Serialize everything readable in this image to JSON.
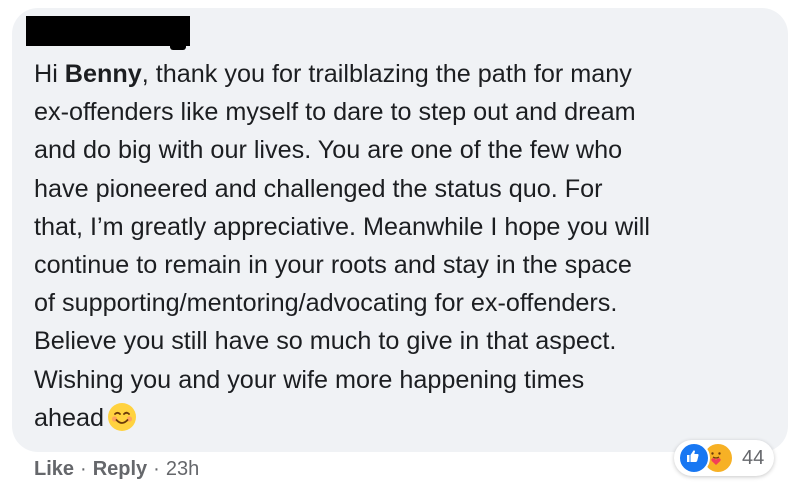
{
  "comment": {
    "lines": [
      [
        "Hi ",
        "Benny",
        ", thank you for trailblazing the path for many"
      ],
      "ex-offenders like myself to dare to step out and dream",
      "and do big with our lives. You are one of the few who",
      "have pioneered and challenged the status quo. For",
      "that, I’m greatly appreciative. Meanwhile I hope you will",
      "continue to remain in your roots and stay in the space",
      "of supporting/mentoring/advocating for ex-offenders.",
      "Believe you still have so much to give in that aspect.",
      "Wishing you and your wife more happening times",
      "ahead"
    ],
    "line1_prefix": "Hi ",
    "mention": "Benny",
    "line1_suffix": ", thank you for trailblazing the path for many",
    "line2": "ex-offenders like myself to dare to step out and dream",
    "line3": "and do big with our lives. You are one of the few who",
    "line4": "have pioneered and challenged the status quo. For",
    "line5": "that, I’m greatly appreciative. Meanwhile I hope you will",
    "line6": "continue to remain in your roots and stay in the space",
    "line7": "of supporting/mentoring/advocating for ex-offenders.",
    "line8": "Believe you still have so much to give in that aspect.",
    "line9": "Wishing you and your wife more happening times",
    "line10": "ahead",
    "emoji": "smiling-face-with-smiling-eyes-icon"
  },
  "reactions": {
    "icons": [
      "like-icon",
      "care-icon"
    ],
    "count": "44"
  },
  "actions": {
    "like_label": "Like",
    "separator": "·",
    "reply_label": "Reply",
    "time": "23h"
  },
  "colors": {
    "bubble": "#f0f2f5",
    "text": "#1c1e21",
    "meta": "#65676b",
    "like_blue": "#1877f2",
    "care_yellow": "#f7b125"
  }
}
